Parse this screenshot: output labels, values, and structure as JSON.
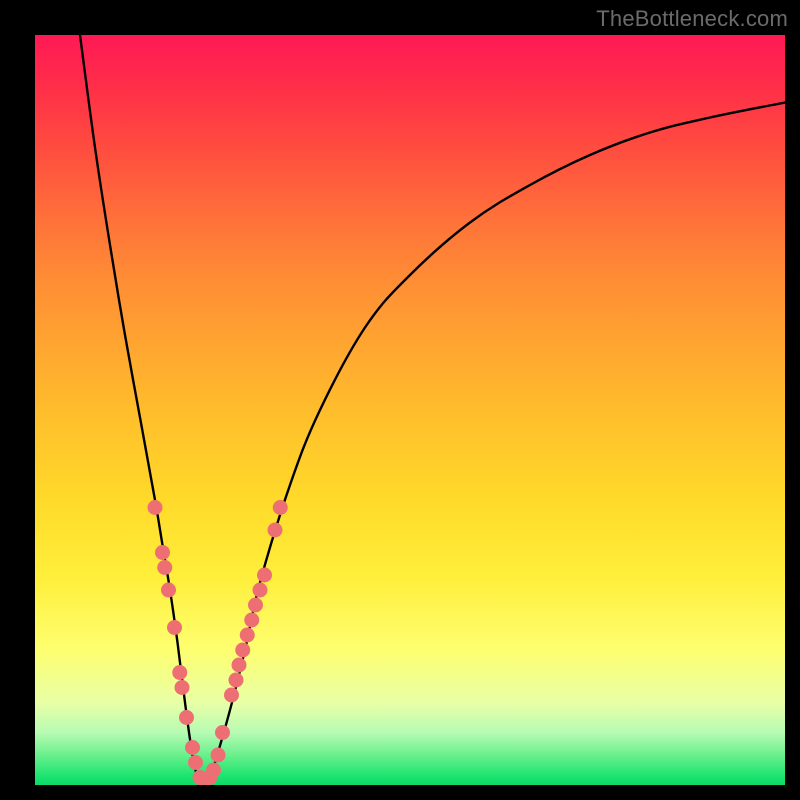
{
  "watermark": "TheBottleneck.com",
  "chart_data": {
    "type": "line",
    "title": "",
    "xlabel": "",
    "ylabel": "",
    "xlim": [
      0,
      100
    ],
    "ylim": [
      0,
      100
    ],
    "grid": false,
    "series": [
      {
        "name": "curve",
        "x": [
          6,
          8,
          10,
          12,
          14,
          16,
          17,
          18,
          19,
          20,
          21,
          22,
          23,
          24,
          26,
          28,
          30,
          34,
          38,
          44,
          50,
          58,
          66,
          74,
          82,
          90,
          100
        ],
        "y": [
          100,
          85,
          72,
          60,
          49,
          38,
          32,
          26,
          19,
          11,
          4,
          0,
          0,
          3,
          10,
          18,
          27,
          40,
          50,
          61,
          68,
          75,
          80,
          84,
          87,
          89,
          91
        ]
      }
    ],
    "markers": {
      "name": "highlight-dots",
      "color": "#ed6f74",
      "points": [
        {
          "x": 16.0,
          "y": 37
        },
        {
          "x": 17.0,
          "y": 31
        },
        {
          "x": 17.3,
          "y": 29
        },
        {
          "x": 17.8,
          "y": 26
        },
        {
          "x": 18.6,
          "y": 21
        },
        {
          "x": 19.3,
          "y": 15
        },
        {
          "x": 19.6,
          "y": 13
        },
        {
          "x": 20.2,
          "y": 9
        },
        {
          "x": 21.0,
          "y": 5
        },
        {
          "x": 21.4,
          "y": 3
        },
        {
          "x": 22.0,
          "y": 1
        },
        {
          "x": 22.6,
          "y": 0
        },
        {
          "x": 23.3,
          "y": 1
        },
        {
          "x": 23.8,
          "y": 2
        },
        {
          "x": 24.4,
          "y": 4
        },
        {
          "x": 25.0,
          "y": 7
        },
        {
          "x": 26.2,
          "y": 12
        },
        {
          "x": 26.8,
          "y": 14
        },
        {
          "x": 27.2,
          "y": 16
        },
        {
          "x": 27.7,
          "y": 18
        },
        {
          "x": 28.3,
          "y": 20
        },
        {
          "x": 28.9,
          "y": 22
        },
        {
          "x": 29.4,
          "y": 24
        },
        {
          "x": 30.0,
          "y": 26
        },
        {
          "x": 30.6,
          "y": 28
        },
        {
          "x": 32.0,
          "y": 34
        },
        {
          "x": 32.7,
          "y": 37
        }
      ]
    }
  }
}
